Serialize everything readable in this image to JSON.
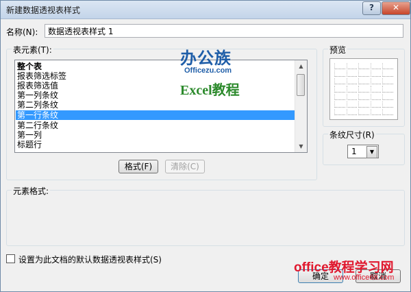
{
  "window": {
    "title": "新建数据透视表样式",
    "help": "?",
    "close": "✕"
  },
  "name_field": {
    "label": "名称(N):",
    "value": "数据透视表样式 1"
  },
  "table_elements": {
    "label": "表元素(T):",
    "items": [
      "整个表",
      "报表筛选标签",
      "报表筛选值",
      "第一列条纹",
      "第二列条纹",
      "第一行条纹",
      "第二行条纹",
      "第一列",
      "标题行"
    ],
    "selected_index": 5
  },
  "buttons": {
    "format": "格式(F)",
    "clear": "清除(C)",
    "ok": "确定",
    "cancel": "取消"
  },
  "preview": {
    "label": "预览"
  },
  "stripe_size": {
    "label": "条纹尺寸(R)",
    "value": "1"
  },
  "element_format": {
    "label": "元素格式:"
  },
  "default_checkbox": {
    "label": "设置为此文档的默认数据透视表样式(S)",
    "checked": false
  },
  "watermarks": {
    "brand_cn": "办公族",
    "brand_url": "Officezu.com",
    "brand_course": "Excel教程",
    "site_cn": "office教程学习网",
    "site_url": "www.office68.com"
  }
}
